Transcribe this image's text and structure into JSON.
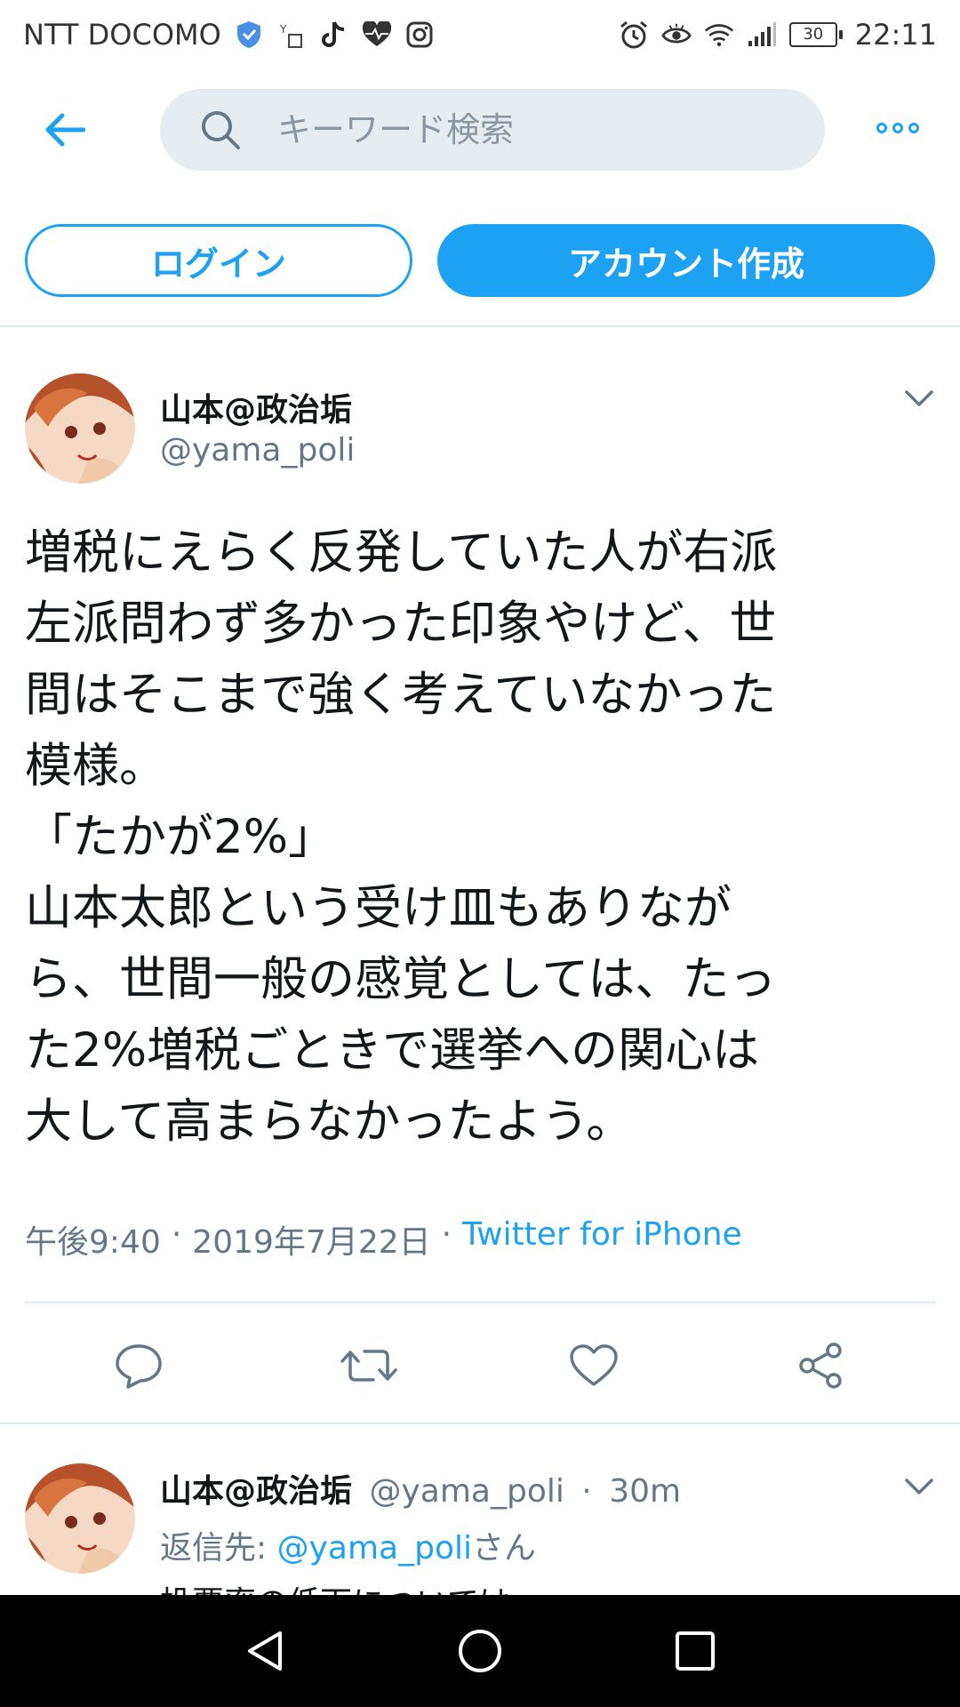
{
  "status_bar": {
    "carrier": "NTT DOCOMO",
    "battery": "30",
    "time": "22:11"
  },
  "search": {
    "placeholder": "キーワード検索"
  },
  "auth": {
    "login_label": "ログイン",
    "signup_label": "アカウント作成"
  },
  "tweet": {
    "author_name": "山本@政治垢",
    "author_handle": "@yama_poli",
    "text": "増税にえらく反発していた人が右派\n左派問わず多かった印象やけど、世\n間はそこまで強く考えていなかった\n模様。\n「たかが2%」\n山本太郎という受け皿もありなが\nら、世間一般の感覚としては、たっ\nた2%増税ごときで選挙への関心は\n大して高まらなかったよう。",
    "time": "午後9:40",
    "date": "2019年7月22日",
    "source": "Twitter for iPhone",
    "sep": "·"
  },
  "reply": {
    "author_name": "山本@政治垢",
    "author_handle": "@yama_poli",
    "age": "30m",
    "reply_prefix": "返信先:",
    "reply_to": "@yama_poli",
    "reply_suffix": "さん",
    "text_preview": "投票率の低下については"
  },
  "colors": {
    "accent": "#1da1f2",
    "secondary_text": "#657786",
    "search_bg": "#e6ecf0"
  }
}
